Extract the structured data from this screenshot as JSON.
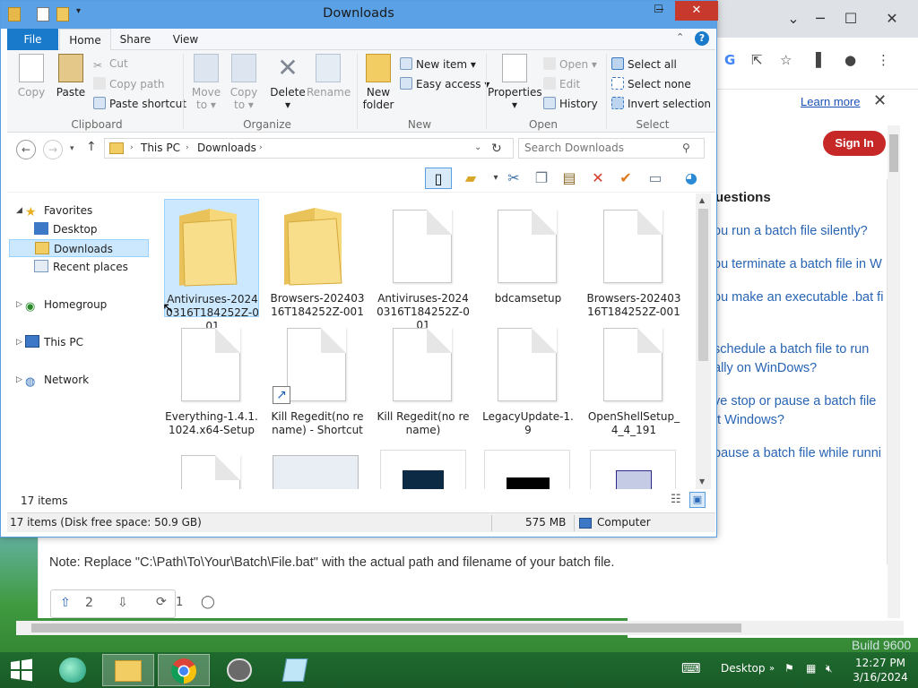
{
  "explorer": {
    "title": "Downloads",
    "tabs": [
      "File",
      "Home",
      "Share",
      "View"
    ],
    "ribbon": {
      "clipboard": {
        "label": "Clipboard",
        "copy": "Copy",
        "paste": "Paste",
        "cut": "Cut",
        "copy_path": "Copy path",
        "paste_shortcut": "Paste shortcut"
      },
      "organize": {
        "label": "Organize",
        "move_to": "Move",
        "move_to2": "to ▾",
        "copy_to": "Copy",
        "copy_to2": "to ▾",
        "delete": "Delete",
        "delete2": "▾",
        "rename": "Rename"
      },
      "new": {
        "label": "New",
        "new_folder": "New",
        "new_folder2": "folder",
        "new_item": "New item ▾",
        "easy_access": "Easy access ▾"
      },
      "open": {
        "label": "Open",
        "properties": "Properties",
        "properties2": "▾",
        "open": "Open ▾",
        "edit": "Edit",
        "history": "History"
      },
      "select": {
        "label": "Select",
        "select_all": "Select all",
        "select_none": "Select none",
        "invert": "Invert selection"
      }
    },
    "address": {
      "parts": [
        "This PC",
        "Downloads"
      ],
      "search_placeholder": "Search Downloads"
    },
    "nav": {
      "favorites": "Favorites",
      "desktop": "Desktop",
      "downloads": "Downloads",
      "recent": "Recent places",
      "homegroup": "Homegroup",
      "this_pc": "This PC",
      "network": "Network"
    },
    "files": [
      {
        "name": "Antiviruses-20240316T184252Z-001",
        "type": "folder"
      },
      {
        "name": "Browsers-20240316T184252Z-001",
        "type": "folder"
      },
      {
        "name": "Antiviruses-20240316T184252Z-001",
        "type": "file"
      },
      {
        "name": "bdcamsetup",
        "type": "file"
      },
      {
        "name": "Browsers-20240316T184252Z-001",
        "type": "file"
      },
      {
        "name": "Everything-1.4.1.1024.x64-Setup",
        "type": "file"
      },
      {
        "name": "Kill Regedit(no rename) - Shortcut",
        "type": "shortcut"
      },
      {
        "name": "Kill Regedit(no rename)",
        "type": "file"
      },
      {
        "name": "LegacyUpdate-1.9",
        "type": "file"
      },
      {
        "name": "OpenShellSetup_4_4_191",
        "type": "file"
      }
    ],
    "item_count": "17 items",
    "status": {
      "summary": "17 items (Disk free space: 50.9 GB)",
      "size": "575 MB",
      "location": "Computer"
    }
  },
  "browser": {
    "learn_more": "Learn more",
    "sign_in": "Sign In",
    "related_title": "uestions",
    "questions": [
      "ou run a batch file silently?",
      "ou terminate a batch file in W",
      "ou make an executable .bat fi",
      "schedule a batch file to run",
      "ally on WinDows?",
      "ve stop or pause a batch file",
      "ft Windows?",
      "pause a batch file while runni"
    ],
    "note": "Note: Replace \"C:\\Path\\To\\Your\\Batch\\File.bat\" with the actual path and filename of your batch file.",
    "upvotes": "2",
    "reposts": "1"
  },
  "desktop": {
    "build": "Build 9600"
  },
  "taskbar": {
    "desktop_label": "Desktop",
    "time": "12:27 PM",
    "date": "3/16/2024"
  },
  "colors": {
    "accent": "#1979ca",
    "selection": "#cce8ff",
    "title_bar": "#5aa1e6",
    "sign_in": "#c62828"
  }
}
